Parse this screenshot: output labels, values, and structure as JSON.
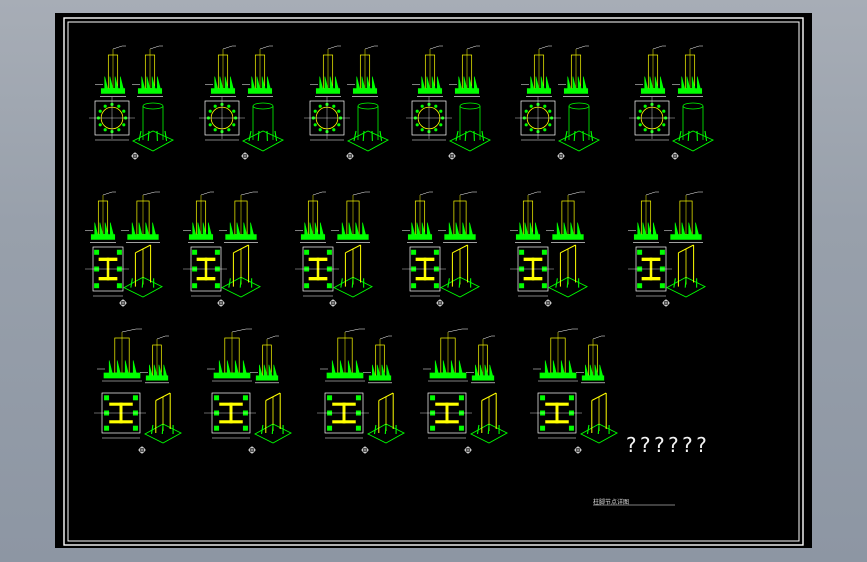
{
  "drawing": {
    "annotation": "??????",
    "title_text": "柱脚节点详图"
  },
  "colors": {
    "background": "#000000",
    "frame": "#ffffff",
    "column": "#ffff00",
    "plate": "#00ff00",
    "dims": "#ffffff"
  },
  "rows": [
    {
      "type": "circular-column",
      "count": 6
    },
    {
      "type": "h-column",
      "count": 6
    },
    {
      "type": "h-column-large",
      "count": 5
    }
  ]
}
